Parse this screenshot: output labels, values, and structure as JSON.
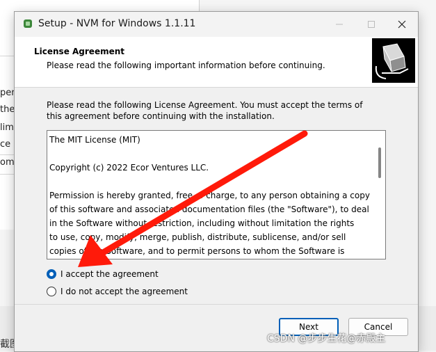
{
  "background": {
    "fragments": [
      "pen",
      "the",
      "lim",
      "ce",
      "om"
    ],
    "caption": "截图给人家看一下"
  },
  "window": {
    "title": "Setup - NVM for Windows 1.1.11"
  },
  "header": {
    "title": "License Agreement",
    "subtitle": "Please read the following important information before continuing."
  },
  "intro_text": "Please read the following License Agreement. You must accept the terms of this agreement before continuing with the installation.",
  "license_lines": [
    "The MIT License (MIT)",
    "",
    "Copyright (c) 2022 Ecor Ventures LLC.",
    "",
    "Permission is hereby granted, free of charge, to any person obtaining a copy",
    "of this software and associated documentation files (the \"Software\"), to deal",
    "in the Software without restriction, including without limitation the rights",
    "to use, copy, modify, merge, publish, distribute, sublicense, and/or sell",
    "copies of the Software, and to permit persons to whom the Software is"
  ],
  "options": {
    "accept": "I accept the agreement",
    "decline": "I do not accept the agreement",
    "selected": "accept"
  },
  "buttons": {
    "next": "Next",
    "cancel": "Cancel"
  },
  "watermark": "CSDN @步步生花@赤殿主",
  "colors": {
    "accent": "#005fb8",
    "arrow": "#ff1a0a"
  }
}
